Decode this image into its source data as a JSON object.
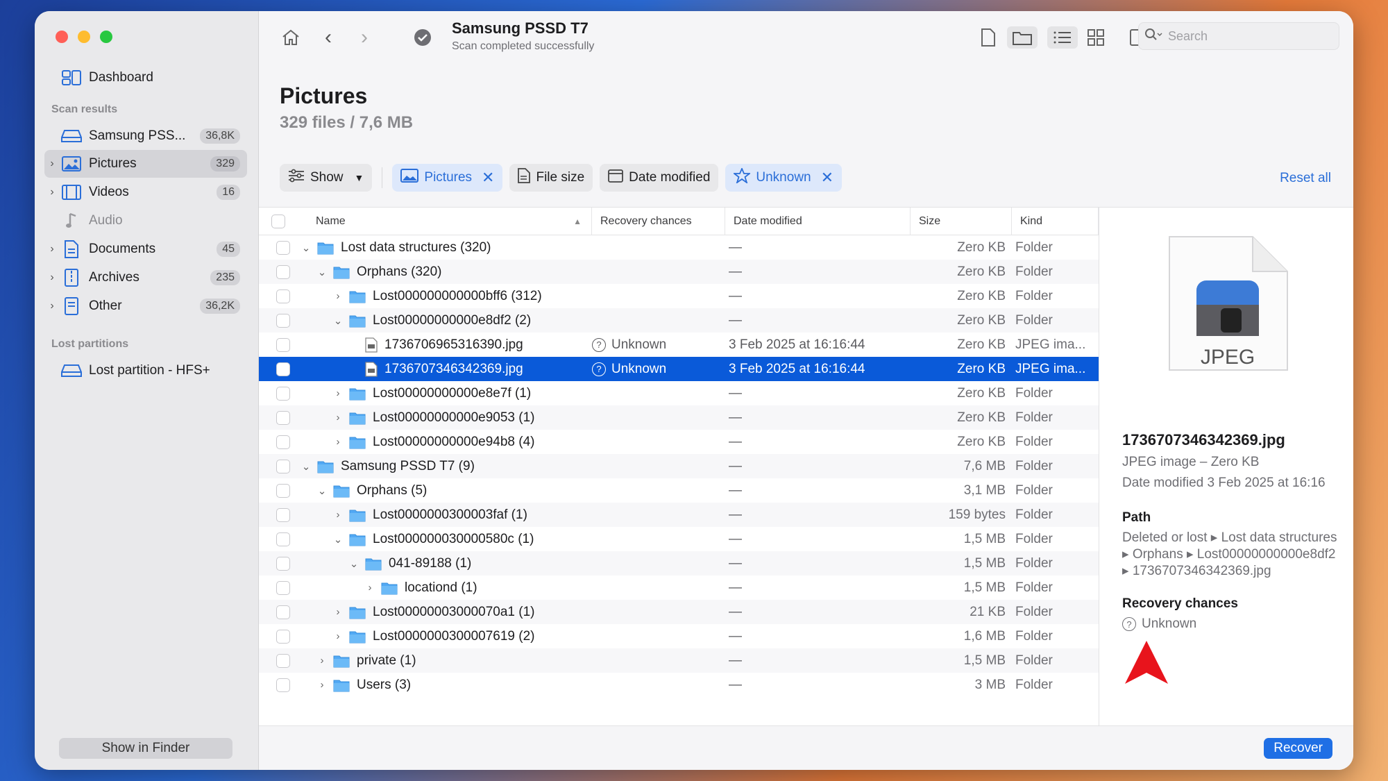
{
  "sidebar": {
    "dashboard": "Dashboard",
    "scan_results_header": "Scan results",
    "items": [
      {
        "label": "Samsung PSS...",
        "badge": "36,8K"
      },
      {
        "label": "Pictures",
        "badge": "329"
      },
      {
        "label": "Videos",
        "badge": "16"
      },
      {
        "label": "Audio",
        "badge": ""
      },
      {
        "label": "Documents",
        "badge": "45"
      },
      {
        "label": "Archives",
        "badge": "235"
      },
      {
        "label": "Other",
        "badge": "36,2K"
      }
    ],
    "lost_partitions_header": "Lost partitions",
    "lost_partition": "Lost partition - HFS+",
    "show_in_finder": "Show in Finder"
  },
  "toolbar": {
    "device": "Samsung PSSD T7",
    "status": "Scan completed successfully",
    "search_placeholder": "Search"
  },
  "header": {
    "title": "Pictures",
    "subtitle": "329 files / 7,6 MB"
  },
  "filters": {
    "show": "Show",
    "pictures": "Pictures",
    "file_size": "File size",
    "date_modified": "Date modified",
    "unknown": "Unknown",
    "reset_all": "Reset all"
  },
  "columns": {
    "name": "Name",
    "recovery": "Recovery chances",
    "date": "Date modified",
    "size": "Size",
    "kind": "Kind"
  },
  "rows": [
    {
      "name": "Lost data structures (320)",
      "rec": "",
      "date": "—",
      "size": "Zero KB",
      "kind": "Folder"
    },
    {
      "name": "Orphans (320)",
      "rec": "",
      "date": "—",
      "size": "Zero KB",
      "kind": "Folder"
    },
    {
      "name": "Lost000000000000bff6 (312)",
      "rec": "",
      "date": "—",
      "size": "Zero KB",
      "kind": "Folder"
    },
    {
      "name": "Lost00000000000e8df2 (2)",
      "rec": "",
      "date": "—",
      "size": "Zero KB",
      "kind": "Folder"
    },
    {
      "name": "1736706965316390.jpg",
      "rec": "Unknown",
      "date": "3 Feb 2025 at 16:16:44",
      "size": "Zero KB",
      "kind": "JPEG ima..."
    },
    {
      "name": "1736707346342369.jpg",
      "rec": "Unknown",
      "date": "3 Feb 2025 at 16:16:44",
      "size": "Zero KB",
      "kind": "JPEG ima..."
    },
    {
      "name": "Lost00000000000e8e7f (1)",
      "rec": "",
      "date": "—",
      "size": "Zero KB",
      "kind": "Folder"
    },
    {
      "name": "Lost00000000000e9053 (1)",
      "rec": "",
      "date": "—",
      "size": "Zero KB",
      "kind": "Folder"
    },
    {
      "name": "Lost00000000000e94b8 (4)",
      "rec": "",
      "date": "—",
      "size": "Zero KB",
      "kind": "Folder"
    },
    {
      "name": "Samsung PSSD T7 (9)",
      "rec": "",
      "date": "—",
      "size": "7,6 MB",
      "kind": "Folder"
    },
    {
      "name": "Orphans (5)",
      "rec": "",
      "date": "—",
      "size": "3,1 MB",
      "kind": "Folder"
    },
    {
      "name": "Lost0000000300003faf (1)",
      "rec": "",
      "date": "—",
      "size": "159 bytes",
      "kind": "Folder"
    },
    {
      "name": "Lost000000030000580c (1)",
      "rec": "",
      "date": "—",
      "size": "1,5 MB",
      "kind": "Folder"
    },
    {
      "name": "041-89188 (1)",
      "rec": "",
      "date": "—",
      "size": "1,5 MB",
      "kind": "Folder"
    },
    {
      "name": "locationd (1)",
      "rec": "",
      "date": "—",
      "size": "1,5 MB",
      "kind": "Folder"
    },
    {
      "name": "Lost00000003000070a1 (1)",
      "rec": "",
      "date": "—",
      "size": "21 KB",
      "kind": "Folder"
    },
    {
      "name": "Lost0000000300007619 (2)",
      "rec": "",
      "date": "—",
      "size": "1,6 MB",
      "kind": "Folder"
    },
    {
      "name": "private (1)",
      "rec": "",
      "date": "—",
      "size": "1,5 MB",
      "kind": "Folder"
    },
    {
      "name": "Users (3)",
      "rec": "",
      "date": "—",
      "size": "3 MB",
      "kind": "Folder"
    }
  ],
  "info": {
    "badge": "JPEG",
    "filename": "1736707346342369.jpg",
    "type": "JPEG image – Zero KB",
    "modified": "Date modified 3 Feb 2025 at 16:16",
    "path_label": "Path",
    "path": "Deleted or lost ▸ Lost data structures ▸ Orphans ▸ Lost00000000000e8df2 ▸ 1736707346342369.jpg",
    "recovery_label": "Recovery chances",
    "recovery": "Unknown"
  },
  "recover": "Recover",
  "colors": {
    "accent": "#0a5ad9",
    "arrow": "#e8141c"
  }
}
